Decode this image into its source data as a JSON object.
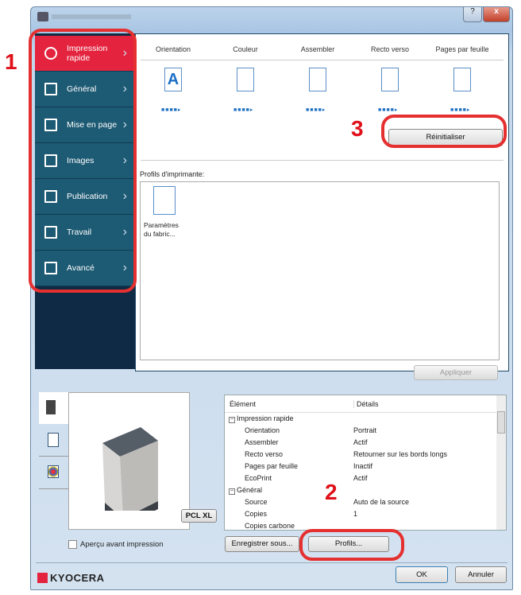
{
  "window": {
    "title_icon": "printer-icon",
    "help": "?",
    "close": "x"
  },
  "sidebar": {
    "items": [
      {
        "label": "Impression\nrapide",
        "icon": "stopwatch-icon",
        "active": true
      },
      {
        "label": "Général",
        "icon": "page-icon"
      },
      {
        "label": "Mise en page",
        "icon": "layout-icon"
      },
      {
        "label": "Images",
        "icon": "image-icon"
      },
      {
        "label": "Publication",
        "icon": "publication-icon"
      },
      {
        "label": "Travail",
        "icon": "job-icon"
      },
      {
        "label": "Avancé",
        "icon": "arrow-icon"
      }
    ]
  },
  "quick": {
    "columns": [
      "Orientation",
      "Couleur",
      "Assembler",
      "Recto verso",
      "Pages par feuille"
    ],
    "reset_label": "Réinitialiser"
  },
  "profiles": {
    "label": "Profils d'imprimante:",
    "items": [
      "Paramètres\ndu fabric..."
    ],
    "apply_label": "Appliquer"
  },
  "preview": {
    "badge": "PCL XL",
    "checkbox_label": "Aperçu avant impression"
  },
  "table": {
    "headers": [
      "Élément",
      "Détails"
    ],
    "rows": [
      {
        "group": true,
        "k": "Impression rapide",
        "v": ""
      },
      {
        "k": "Orientation",
        "v": "Portrait"
      },
      {
        "k": "Assembler",
        "v": "Actif"
      },
      {
        "k": "Recto verso",
        "v": "Retourner sur les bords longs"
      },
      {
        "k": "Pages par feuille",
        "v": "Inactif"
      },
      {
        "k": "EcoPrint",
        "v": "Actif"
      },
      {
        "group": true,
        "k": "Général",
        "v": ""
      },
      {
        "k": "Source",
        "v": "Auto de la source"
      },
      {
        "k": "Copies",
        "v": "1"
      },
      {
        "k": "Copies carbone",
        "v": ""
      }
    ]
  },
  "buttons": {
    "save_as": "Enregistrer sous...",
    "profiles": "Profils...",
    "ok": "OK",
    "cancel": "Annuler"
  },
  "brand": "KYOCERA",
  "annotations": [
    "1",
    "2",
    "3"
  ],
  "colors": {
    "accent": "#e4243f",
    "sidebar": "#1d5a73",
    "annotation": "#e53030"
  }
}
